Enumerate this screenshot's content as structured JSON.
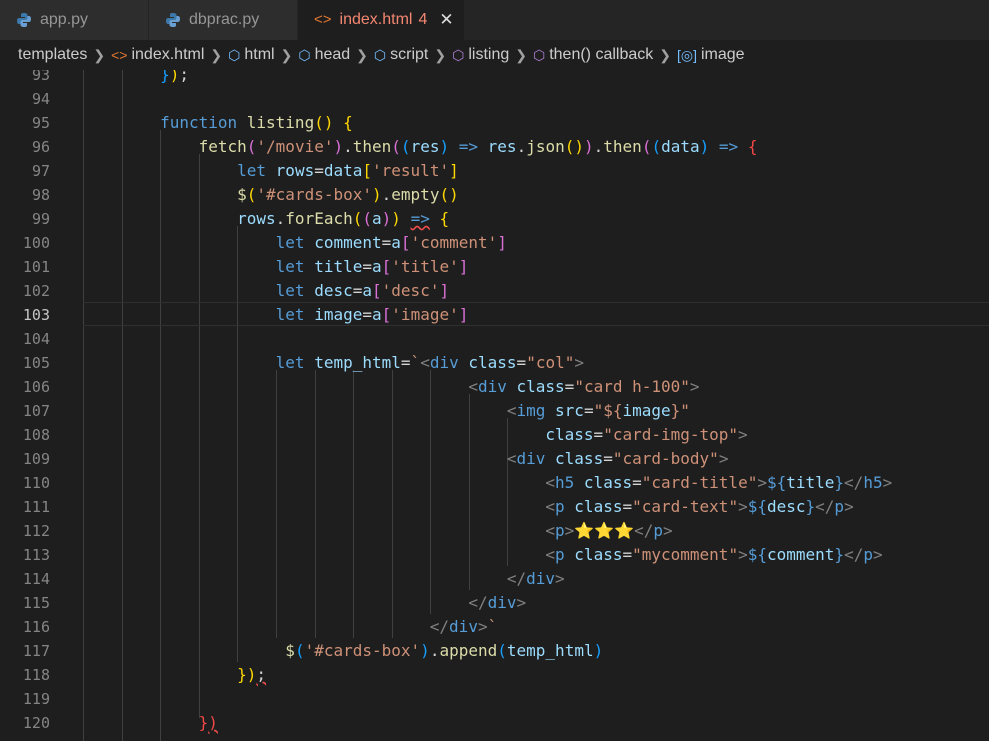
{
  "tabs": [
    {
      "label": "app.py",
      "icon": "python-icon"
    },
    {
      "label": "dbprac.py",
      "icon": "python-icon"
    },
    {
      "label": "index.html",
      "badge": "4",
      "icon": "html-icon",
      "active": true
    }
  ],
  "breadcrumbs": [
    {
      "label": "templates",
      "icon": ""
    },
    {
      "label": "index.html",
      "icon": "html-icon"
    },
    {
      "label": "html",
      "icon": "cube-icon"
    },
    {
      "label": "head",
      "icon": "cube-icon"
    },
    {
      "label": "script",
      "icon": "cube-icon"
    },
    {
      "label": "listing",
      "icon": "function-icon"
    },
    {
      "label": "then() callback",
      "icon": "function-icon"
    },
    {
      "label": "image",
      "icon": "variable-icon"
    }
  ],
  "lines": [
    {
      "n": "93",
      "t": [
        [
          "        ",
          ""
        ],
        [
          "}",
          "b3"
        ],
        [
          ")",
          "b1"
        ],
        [
          ";",
          "pu"
        ]
      ]
    },
    {
      "n": "94",
      "t": []
    },
    {
      "n": "95",
      "t": [
        [
          "        ",
          ""
        ],
        [
          "function",
          "kw"
        ],
        [
          " ",
          ""
        ],
        [
          "listing",
          "fn"
        ],
        [
          "()",
          "b1"
        ],
        [
          " ",
          ""
        ],
        [
          "{",
          "b1"
        ]
      ]
    },
    {
      "n": "96",
      "t": [
        [
          "            ",
          ""
        ],
        [
          "fetch",
          "fn"
        ],
        [
          "(",
          "b2"
        ],
        [
          "'/movie'",
          "str"
        ],
        [
          ")",
          "b2"
        ],
        [
          ".",
          "pu"
        ],
        [
          "then",
          "fn"
        ],
        [
          "(",
          "b2"
        ],
        [
          "(",
          "b3"
        ],
        [
          "res",
          "var"
        ],
        [
          ")",
          "b3"
        ],
        [
          " ",
          ""
        ],
        [
          "=>",
          "kw"
        ],
        [
          " ",
          ""
        ],
        [
          "res",
          "var"
        ],
        [
          ".",
          "pu"
        ],
        [
          "json",
          "fn"
        ],
        [
          "()",
          "b1"
        ],
        [
          ")",
          "b2"
        ],
        [
          ".",
          "pu"
        ],
        [
          "then",
          "fn"
        ],
        [
          "(",
          "b2"
        ],
        [
          "(",
          "b3"
        ],
        [
          "data",
          "var"
        ],
        [
          ")",
          "b3"
        ],
        [
          " ",
          ""
        ],
        [
          "=>",
          "kw"
        ],
        [
          " ",
          ""
        ],
        [
          "{",
          "err"
        ]
      ]
    },
    {
      "n": "97",
      "t": [
        [
          "                ",
          ""
        ],
        [
          "let",
          "kw"
        ],
        [
          " ",
          ""
        ],
        [
          "rows",
          "var"
        ],
        [
          "=",
          "pu"
        ],
        [
          "data",
          "var"
        ],
        [
          "[",
          "b1"
        ],
        [
          "'result'",
          "str"
        ],
        [
          "]",
          "b1"
        ]
      ]
    },
    {
      "n": "98",
      "t": [
        [
          "                ",
          ""
        ],
        [
          "$",
          "fn"
        ],
        [
          "(",
          "b1"
        ],
        [
          "'#cards-box'",
          "str"
        ],
        [
          ")",
          "b1"
        ],
        [
          ".",
          "pu"
        ],
        [
          "empty",
          "fn"
        ],
        [
          "()",
          "b1"
        ]
      ]
    },
    {
      "n": "99",
      "t": [
        [
          "                ",
          ""
        ],
        [
          "rows",
          "var"
        ],
        [
          ".",
          "pu"
        ],
        [
          "forEach",
          "fn"
        ],
        [
          "(",
          "b1"
        ],
        [
          "(",
          "b2"
        ],
        [
          "a",
          "var"
        ],
        [
          ")",
          "b2"
        ],
        [
          ")",
          "b1"
        ],
        [
          " ",
          ""
        ],
        [
          "=>",
          "kw sq"
        ],
        [
          " ",
          ""
        ],
        [
          "{",
          "b1"
        ]
      ]
    },
    {
      "n": "100",
      "t": [
        [
          "                    ",
          ""
        ],
        [
          "let",
          "kw"
        ],
        [
          " ",
          ""
        ],
        [
          "comment",
          "var"
        ],
        [
          "=",
          "pu"
        ],
        [
          "a",
          "var"
        ],
        [
          "[",
          "b2"
        ],
        [
          "'comment'",
          "str"
        ],
        [
          "]",
          "b2"
        ]
      ]
    },
    {
      "n": "101",
      "t": [
        [
          "                    ",
          ""
        ],
        [
          "let",
          "kw"
        ],
        [
          " ",
          ""
        ],
        [
          "title",
          "var"
        ],
        [
          "=",
          "pu"
        ],
        [
          "a",
          "var"
        ],
        [
          "[",
          "b2"
        ],
        [
          "'title'",
          "str"
        ],
        [
          "]",
          "b2"
        ]
      ]
    },
    {
      "n": "102",
      "t": [
        [
          "                    ",
          ""
        ],
        [
          "let",
          "kw"
        ],
        [
          " ",
          ""
        ],
        [
          "desc",
          "var"
        ],
        [
          "=",
          "pu"
        ],
        [
          "a",
          "var"
        ],
        [
          "[",
          "b2"
        ],
        [
          "'desc'",
          "str"
        ],
        [
          "]",
          "b2"
        ]
      ]
    },
    {
      "n": "103",
      "t": [
        [
          "                    ",
          ""
        ],
        [
          "let",
          "kw"
        ],
        [
          " ",
          ""
        ],
        [
          "image",
          "var"
        ],
        [
          "=",
          "pu"
        ],
        [
          "a",
          "var"
        ],
        [
          "[",
          "b2"
        ],
        [
          "'image'",
          "str"
        ],
        [
          "]",
          "b2"
        ]
      ]
    },
    {
      "n": "104",
      "t": []
    },
    {
      "n": "105",
      "t": [
        [
          "                    ",
          ""
        ],
        [
          "let",
          "kw"
        ],
        [
          " ",
          ""
        ],
        [
          "temp_html",
          "var"
        ],
        [
          "=",
          "pu"
        ],
        [
          "`",
          "str"
        ],
        [
          "<",
          "tag"
        ],
        [
          "div",
          "tn"
        ],
        [
          " ",
          ""
        ],
        [
          "class",
          "attr"
        ],
        [
          "=",
          "pu"
        ],
        [
          "\"col\"",
          "str"
        ],
        [
          ">",
          "tag"
        ]
      ]
    },
    {
      "n": "106",
      "t": [
        [
          "                        ",
          ""
        ],
        [
          "        ",
          ""
        ],
        [
          "        ",
          ""
        ],
        [
          "<",
          "tag"
        ],
        [
          "div",
          "tn"
        ],
        [
          " ",
          ""
        ],
        [
          "class",
          "attr"
        ],
        [
          "=",
          "pu"
        ],
        [
          "\"card h-100\"",
          "str"
        ],
        [
          ">",
          "tag"
        ]
      ]
    },
    {
      "n": "107",
      "t": [
        [
          "                        ",
          ""
        ],
        [
          "            ",
          ""
        ],
        [
          "        ",
          ""
        ],
        [
          "<",
          "tag"
        ],
        [
          "img",
          "tn"
        ],
        [
          " ",
          ""
        ],
        [
          "src",
          "attr"
        ],
        [
          "=",
          "pu"
        ],
        [
          "\"${",
          "str"
        ],
        [
          "image",
          "var"
        ],
        [
          "}\"",
          "str"
        ]
      ]
    },
    {
      "n": "108",
      "t": [
        [
          "                        ",
          ""
        ],
        [
          "                ",
          ""
        ],
        [
          "        ",
          ""
        ],
        [
          "class",
          "attr"
        ],
        [
          "=",
          "pu"
        ],
        [
          "\"card-img-top\"",
          "str"
        ],
        [
          ">",
          "tag"
        ]
      ]
    },
    {
      "n": "109",
      "t": [
        [
          "                        ",
          ""
        ],
        [
          "            ",
          ""
        ],
        [
          "        ",
          ""
        ],
        [
          "<",
          "tag"
        ],
        [
          "div",
          "tn"
        ],
        [
          " ",
          ""
        ],
        [
          "class",
          "attr"
        ],
        [
          "=",
          "pu"
        ],
        [
          "\"card-body\"",
          "str"
        ],
        [
          ">",
          "tag"
        ]
      ]
    },
    {
      "n": "110",
      "t": [
        [
          "                        ",
          ""
        ],
        [
          "                ",
          ""
        ],
        [
          "        ",
          ""
        ],
        [
          "<",
          "tag"
        ],
        [
          "h5",
          "tn"
        ],
        [
          " ",
          ""
        ],
        [
          "class",
          "attr"
        ],
        [
          "=",
          "pu"
        ],
        [
          "\"card-title\"",
          "str"
        ],
        [
          ">",
          "tag"
        ],
        [
          "${",
          "kw"
        ],
        [
          "title",
          "var"
        ],
        [
          "}",
          "kw"
        ],
        [
          "</",
          "tag"
        ],
        [
          "h5",
          "tn"
        ],
        [
          ">",
          "tag"
        ]
      ]
    },
    {
      "n": "111",
      "t": [
        [
          "                        ",
          ""
        ],
        [
          "                ",
          ""
        ],
        [
          "        ",
          ""
        ],
        [
          "<",
          "tag"
        ],
        [
          "p",
          "tn"
        ],
        [
          " ",
          ""
        ],
        [
          "class",
          "attr"
        ],
        [
          "=",
          "pu"
        ],
        [
          "\"card-text\"",
          "str"
        ],
        [
          ">",
          "tag"
        ],
        [
          "${",
          "kw"
        ],
        [
          "desc",
          "var"
        ],
        [
          "}",
          "kw"
        ],
        [
          "</",
          "tag"
        ],
        [
          "p",
          "tn"
        ],
        [
          ">",
          "tag"
        ]
      ]
    },
    {
      "n": "112",
      "t": [
        [
          "                        ",
          ""
        ],
        [
          "                ",
          ""
        ],
        [
          "        ",
          ""
        ],
        [
          "<",
          "tag"
        ],
        [
          "p",
          "tn"
        ],
        [
          ">",
          "tag"
        ],
        [
          "⭐⭐⭐",
          "str"
        ],
        [
          "</",
          "tag"
        ],
        [
          "p",
          "tn"
        ],
        [
          ">",
          "tag"
        ]
      ]
    },
    {
      "n": "113",
      "t": [
        [
          "                        ",
          ""
        ],
        [
          "                ",
          ""
        ],
        [
          "        ",
          ""
        ],
        [
          "<",
          "tag"
        ],
        [
          "p",
          "tn"
        ],
        [
          " ",
          ""
        ],
        [
          "class",
          "attr"
        ],
        [
          "=",
          "pu"
        ],
        [
          "\"mycomment\"",
          "str"
        ],
        [
          ">",
          "tag"
        ],
        [
          "${",
          "kw"
        ],
        [
          "comment",
          "var"
        ],
        [
          "}",
          "kw"
        ],
        [
          "</",
          "tag"
        ],
        [
          "p",
          "tn"
        ],
        [
          ">",
          "tag"
        ]
      ]
    },
    {
      "n": "114",
      "t": [
        [
          "                        ",
          ""
        ],
        [
          "            ",
          ""
        ],
        [
          "        ",
          ""
        ],
        [
          "</",
          "tag"
        ],
        [
          "div",
          "tn"
        ],
        [
          ">",
          "tag"
        ]
      ]
    },
    {
      "n": "115",
      "t": [
        [
          "                        ",
          ""
        ],
        [
          "        ",
          ""
        ],
        [
          "        ",
          ""
        ],
        [
          "</",
          "tag"
        ],
        [
          "div",
          "tn"
        ],
        [
          ">",
          "tag"
        ]
      ]
    },
    {
      "n": "116",
      "t": [
        [
          "                        ",
          ""
        ],
        [
          "    ",
          ""
        ],
        [
          "        ",
          ""
        ],
        [
          "</",
          "tag"
        ],
        [
          "div",
          "tn"
        ],
        [
          ">",
          "tag"
        ],
        [
          "`",
          "str"
        ]
      ]
    },
    {
      "n": "117",
      "t": [
        [
          "                     ",
          ""
        ],
        [
          "$",
          "fn"
        ],
        [
          "(",
          "b3"
        ],
        [
          "'#cards-box'",
          "str"
        ],
        [
          ")",
          "b3"
        ],
        [
          ".",
          "pu"
        ],
        [
          "append",
          "fn"
        ],
        [
          "(",
          "b3"
        ],
        [
          "temp_html",
          "var"
        ],
        [
          ")",
          "b3"
        ]
      ]
    },
    {
      "n": "118",
      "t": [
        [
          "                ",
          ""
        ],
        [
          "}",
          "b1"
        ],
        [
          ")",
          "b1"
        ],
        [
          ";",
          "pu sq"
        ]
      ]
    },
    {
      "n": "119",
      "t": []
    },
    {
      "n": "120",
      "t": [
        [
          "            ",
          ""
        ],
        [
          "}",
          "err"
        ],
        [
          ")",
          "err sq"
        ]
      ]
    }
  ],
  "current_line": "103"
}
